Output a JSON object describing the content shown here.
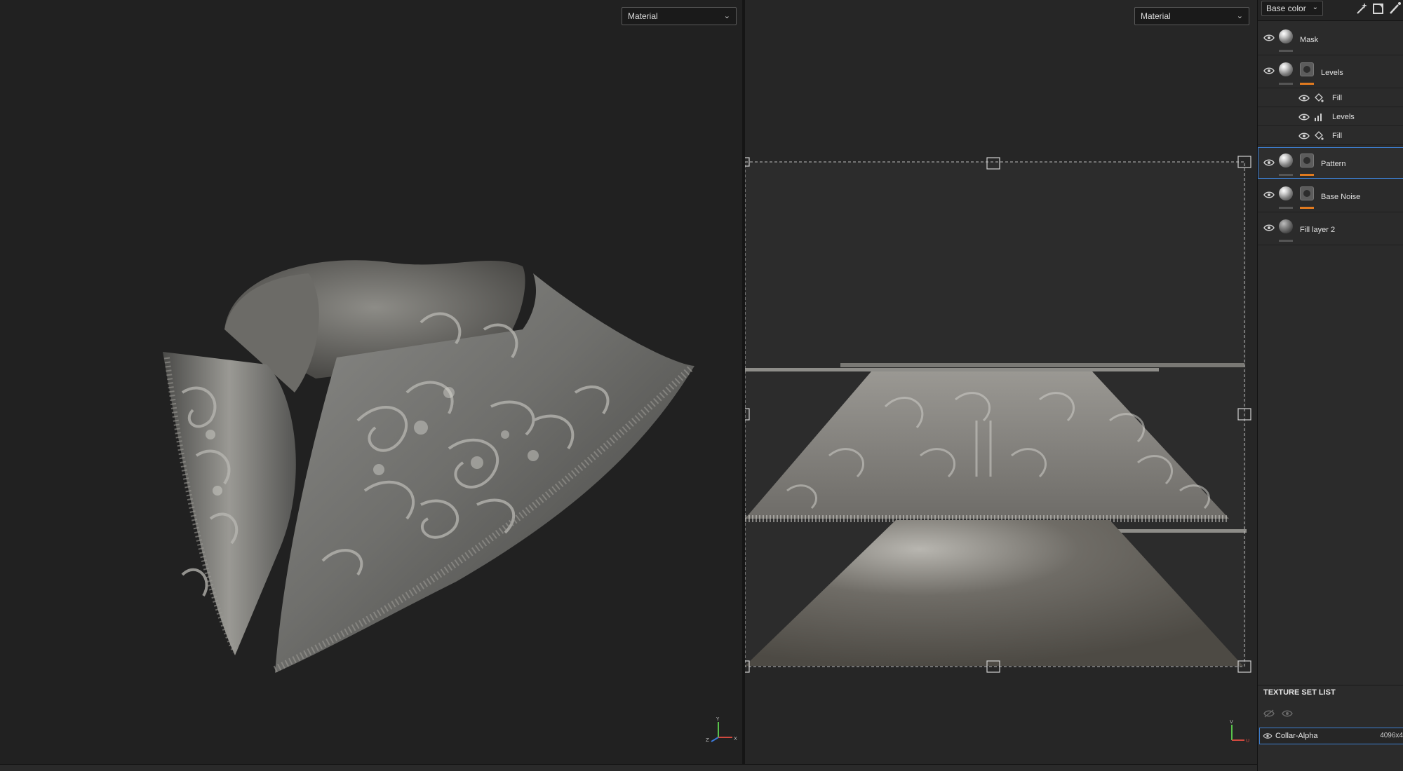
{
  "viewport3d": {
    "mode_label": "Material"
  },
  "viewport2d": {
    "mode_label": "Material"
  },
  "gizmo3d": {
    "y": "Y",
    "x": "X",
    "z": "Z"
  },
  "gizmo2d": {
    "v": "V",
    "u": "U"
  },
  "panel": {
    "channel_label": "Base color",
    "layers": [
      {
        "name": "Mask",
        "type": "layer"
      },
      {
        "name": "Levels",
        "type": "layer",
        "has_mask": true
      },
      {
        "name": "Fill",
        "type": "effect",
        "icon": "fill-icon"
      },
      {
        "name": "Levels",
        "type": "effect",
        "icon": "levels-icon"
      },
      {
        "name": "Fill",
        "type": "effect",
        "icon": "fill-icon"
      },
      {
        "name": "Pattern",
        "type": "layer",
        "has_mask": true,
        "selected": true
      },
      {
        "name": "Base Noise",
        "type": "layer",
        "has_mask": true
      },
      {
        "name": "Fill layer 2",
        "type": "layer"
      }
    ],
    "texture_set_list": {
      "title": "TEXTURE SET LIST",
      "items": [
        {
          "name": "Collar-Alpha",
          "resolution": "4096x4"
        }
      ]
    }
  },
  "colors": {
    "accent": "#e07a1f",
    "selection": "#3d7fd1",
    "viewport_bg": "#212121"
  }
}
